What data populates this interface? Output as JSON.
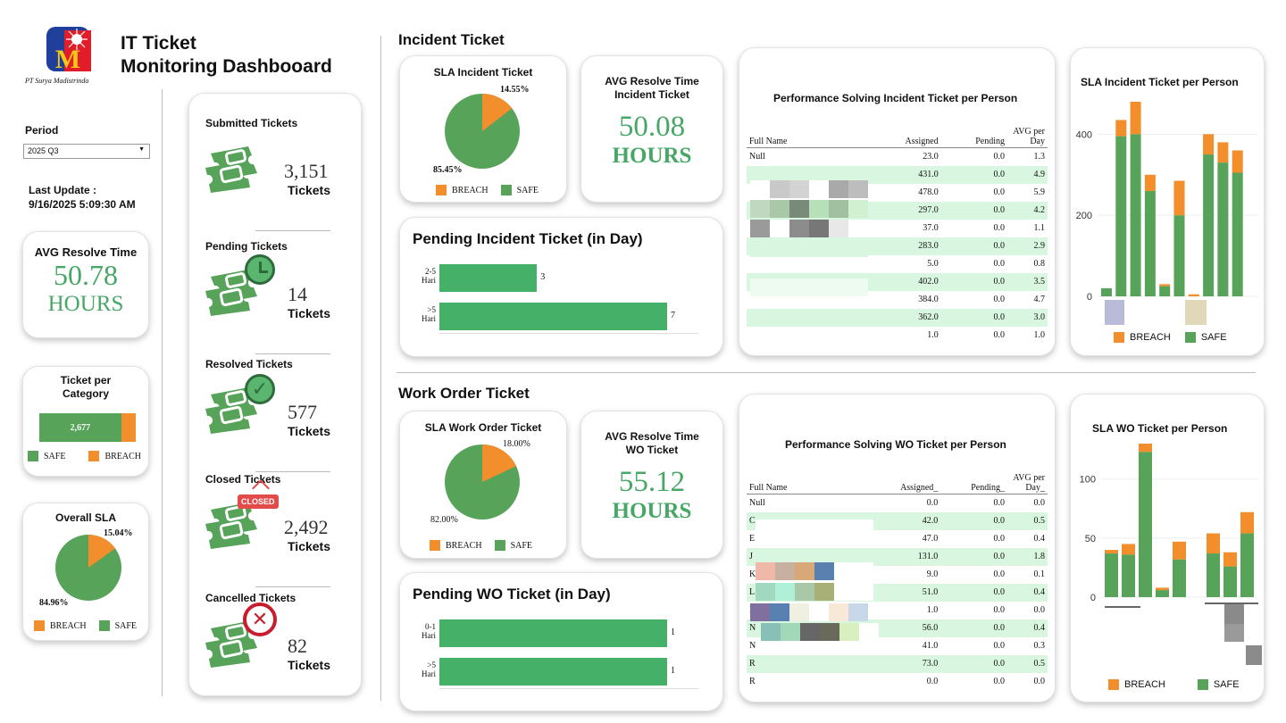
{
  "header": {
    "title_line1": "IT Ticket",
    "title_line2": "Monitoring Dashbooard",
    "company": "PT Surya Madistrindo",
    "logo_text": "SM"
  },
  "filters": {
    "period_label": "Period",
    "period_value": "2025 Q3",
    "last_update_label": "Last Update :",
    "last_update_value": "9/16/2025 5:09:30 AM"
  },
  "avg_overall": {
    "title": "AVG Resolve Time",
    "value": "50.78",
    "unit": "HOURS"
  },
  "category": {
    "title_line1": "Ticket per",
    "title_line2": "Category",
    "safe_value": "2,677",
    "safe_fraction": 0.85,
    "legend_safe": "SAFE",
    "legend_breach": "BREACH"
  },
  "overall_sla": {
    "title": "Overall SLA",
    "breach_pct": "15.04%",
    "safe_pct": "84.96%",
    "breach_value": 15.04,
    "legend_breach": "BREACH",
    "legend_safe": "SAFE"
  },
  "tickets": [
    {
      "label": "Submitted Tickets",
      "value": "3,151",
      "unit": "Tickets",
      "badge": "none"
    },
    {
      "label": "Pending Tickets",
      "value": "14",
      "unit": "Tickets",
      "badge": "clock"
    },
    {
      "label": "Resolved Tickets",
      "value": "577",
      "unit": "Tickets",
      "badge": "check"
    },
    {
      "label": "Closed Tickets",
      "value": "2,492",
      "unit": "Tickets",
      "badge": "closed",
      "badge_text": "CLOSED"
    },
    {
      "label": "Cancelled Tickets",
      "value": "82",
      "unit": "Tickets",
      "badge": "cross"
    }
  ],
  "incident": {
    "section_title": "Incident Ticket",
    "sla": {
      "title": "SLA Incident Ticket",
      "breach_pct": "14.55%",
      "safe_pct": "85.45%",
      "breach_value": 14.55,
      "legend_breach": "BREACH",
      "legend_safe": "SAFE"
    },
    "avg": {
      "title_line1": "AVG Resolve Time",
      "title_line2": "Incident Ticket",
      "value": "50.08",
      "unit": "HOURS"
    },
    "pending": {
      "title": "Pending Incident Ticket (in Day)",
      "rows": [
        {
          "l1": "2-5",
          "l2": "Hari",
          "value": 3
        },
        {
          "l1": ">5",
          "l2": "Hari",
          "value": 7
        }
      ],
      "max": 7
    },
    "perf": {
      "title": "Performance Solving Incident Ticket per Person",
      "headers": [
        "Full Name",
        "Assigned",
        "Pending",
        "AVG per Day"
      ],
      "rows": [
        [
          "Null",
          "23.0",
          "0.0",
          "1.3"
        ],
        [
          "",
          "431.0",
          "0.0",
          "4.9"
        ],
        [
          "",
          "478.0",
          "0.0",
          "5.9"
        ],
        [
          "",
          "297.0",
          "0.0",
          "4.2"
        ],
        [
          "",
          "37.0",
          "0.0",
          "1.1"
        ],
        [
          "",
          "283.0",
          "0.0",
          "2.9"
        ],
        [
          "",
          "5.0",
          "0.0",
          "0.8"
        ],
        [
          "",
          "402.0",
          "0.0",
          "3.5"
        ],
        [
          "",
          "384.0",
          "0.0",
          "4.7"
        ],
        [
          "",
          "362.0",
          "0.0",
          "3.0"
        ],
        [
          "",
          "1.0",
          "0.0",
          "1.0"
        ]
      ]
    },
    "sla_person": {
      "title": "SLA Incident Ticket per Person",
      "legend_breach": "BREACH",
      "legend_safe": "SAFE",
      "ticks": [
        "400",
        "200",
        "0"
      ]
    }
  },
  "wo": {
    "section_title": "Work Order Ticket",
    "sla": {
      "title": "SLA Work Order Ticket",
      "breach_pct": "18.00%",
      "safe_pct": "82.00%",
      "breach_value": 18.0,
      "legend_breach": "BREACH",
      "legend_safe": "SAFE"
    },
    "avg": {
      "title_line1": "AVG Resolve Time",
      "title_line2": "WO Ticket",
      "value": "55.12",
      "unit": "HOURS"
    },
    "pending": {
      "title": "Pending WO Ticket (in Day)",
      "rows": [
        {
          "l1": "0-1",
          "l2": "Hari",
          "value": 1
        },
        {
          "l1": ">5",
          "l2": "Hari",
          "value": 1
        }
      ],
      "max": 1
    },
    "perf": {
      "title": "Performance Solving WO Ticket per Person",
      "headers": [
        "Full Name",
        "Assigned_",
        "Pending_",
        "AVG per Day_"
      ],
      "rows": [
        [
          "Null",
          "0.0",
          "0.0",
          "0.0"
        ],
        [
          "C",
          "42.0",
          "0.0",
          "0.5"
        ],
        [
          "E",
          "47.0",
          "0.0",
          "0.4"
        ],
        [
          "J",
          "131.0",
          "0.0",
          "1.8"
        ],
        [
          "K",
          "9.0",
          "0.0",
          "0.1"
        ],
        [
          "L",
          "51.0",
          "0.0",
          "0.4"
        ],
        [
          "N",
          "1.0",
          "0.0",
          "0.0"
        ],
        [
          "N",
          "56.0",
          "0.0",
          "0.4"
        ],
        [
          "N",
          "41.0",
          "0.0",
          "0.3"
        ],
        [
          "R",
          "73.0",
          "0.0",
          "0.5"
        ],
        [
          "R",
          "0.0",
          "0.0",
          "0.0"
        ]
      ]
    },
    "sla_person": {
      "title": "SLA WO Ticket per Person",
      "legend_breach": "BREACH",
      "legend_safe": "SAFE",
      "ticks": [
        "100",
        "50",
        "0"
      ]
    }
  },
  "chart_data": [
    {
      "type": "pie",
      "title": "Overall SLA",
      "categories": [
        "BREACH",
        "SAFE"
      ],
      "values": [
        15.04,
        84.96
      ]
    },
    {
      "type": "bar",
      "title": "Ticket per Category",
      "categories": [
        "SAFE",
        "BREACH"
      ],
      "values": [
        2677,
        null
      ]
    },
    {
      "type": "pie",
      "title": "SLA Incident Ticket",
      "categories": [
        "BREACH",
        "SAFE"
      ],
      "values": [
        14.55,
        85.45
      ]
    },
    {
      "type": "bar",
      "title": "Pending Incident Ticket (in Day)",
      "categories": [
        "2-5 Hari",
        ">5 Hari"
      ],
      "values": [
        3,
        7
      ]
    },
    {
      "type": "bar",
      "title": "SLA Incident Ticket per Person",
      "stacked": true,
      "ylim": [
        0,
        480
      ],
      "series": [
        {
          "name": "SAFE",
          "values": [
            20,
            395,
            400,
            260,
            25,
            200,
            0,
            350,
            330,
            305
          ]
        },
        {
          "name": "BREACH",
          "values": [
            0,
            40,
            80,
            40,
            5,
            85,
            5,
            50,
            50,
            55
          ]
        }
      ]
    },
    {
      "type": "pie",
      "title": "SLA Work Order Ticket",
      "categories": [
        "BREACH",
        "SAFE"
      ],
      "values": [
        18.0,
        82.0
      ]
    },
    {
      "type": "bar",
      "title": "Pending WO Ticket (in Day)",
      "categories": [
        "0-1 Hari",
        ">5 Hari"
      ],
      "values": [
        1,
        1
      ]
    },
    {
      "type": "bar",
      "title": "SLA WO Ticket per Person",
      "stacked": true,
      "ylim": [
        0,
        130
      ],
      "series": [
        {
          "name": "SAFE",
          "values": [
            37,
            36,
            123,
            6,
            32,
            0,
            37,
            26,
            54
          ]
        },
        {
          "name": "BREACH",
          "values": [
            3,
            9,
            9,
            2,
            15,
            0,
            17,
            12,
            18
          ]
        }
      ]
    }
  ],
  "colors": {
    "breach": "#f28e2b",
    "safe": "#57a35a",
    "bar": "#45b168",
    "accent_text": "#47a766",
    "row_alt": "#d9f7e0"
  }
}
